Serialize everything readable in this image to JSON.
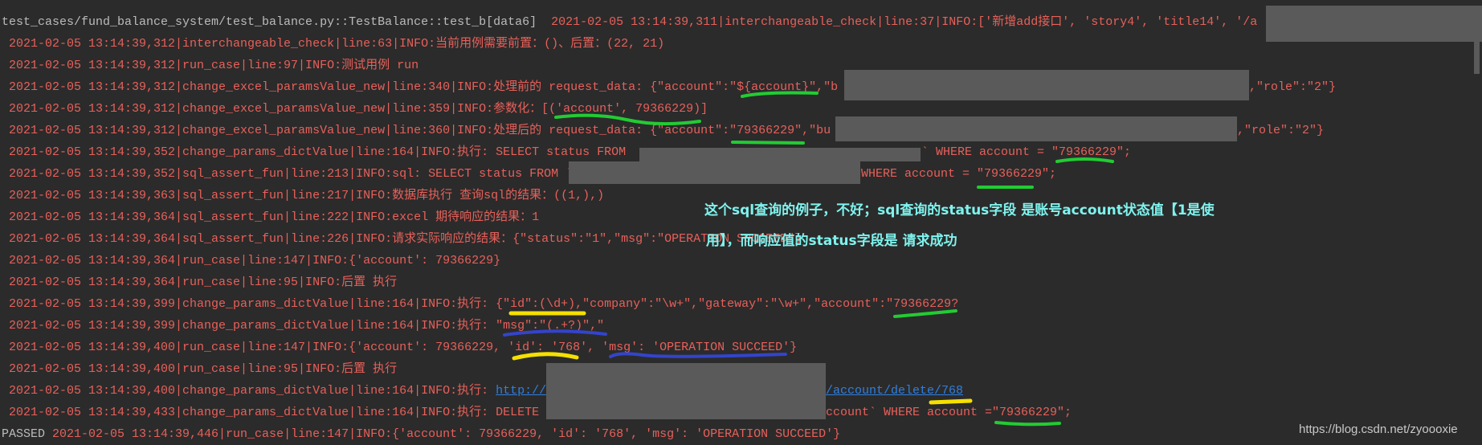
{
  "log": {
    "lines": [
      {
        "test": "test_cases/fund_balance_system/test_balance.py::TestBalance::test_b[data6]",
        "text": "  2021-02-05 13:14:39,311|interchangeable_check|line:37|INFO:['新增add接口', 'story4', 'title14', '/a"
      },
      {
        "text": " 2021-02-05 13:14:39,312|interchangeable_check|line:63|INFO:当前用例需要前置：()、后置：(22, 21)"
      },
      {
        "text": " 2021-02-05 13:14:39,312|run_case|line:97|INFO:测试用例 run"
      },
      {
        "text": " 2021-02-05 13:14:39,312|change_excel_paramsValue_new|line:340|INFO:处理前的 request_data: {\"account\":\"${account}\",\"b",
        "tail": ",\"role\":\"2\"}"
      },
      {
        "text": " 2021-02-05 13:14:39,312|change_excel_paramsValue_new|line:359|INFO:参数化：[('account', 79366229)]"
      },
      {
        "text": " 2021-02-05 13:14:39,312|change_excel_paramsValue_new|line:360|INFO:处理后的 request_data: {\"account\":\"79366229\",\"bu",
        "tail": ",\"role\":\"2\"}"
      },
      {
        "text": " 2021-02-05 13:14:39,352|change_params_dictValue|line:164|INFO:执行: SELECT status FROM ",
        "tail": "` WHERE account = \"79366229\";"
      },
      {
        "text": " 2021-02-05 13:14:39,352|sql_assert_fun|line:213|INFO:sql: SELECT status FROM `",
        "tail": "WHERE account = \"79366229\";"
      },
      {
        "text": " 2021-02-05 13:14:39,363|sql_assert_fun|line:217|INFO:数据库执行 查询sql的结果：((1,),)"
      },
      {
        "text": " 2021-02-05 13:14:39,364|sql_assert_fun|line:222|INFO:excel 期待响应的结果：1"
      },
      {
        "text": " 2021-02-05 13:14:39,364|sql_assert_fun|line:226|INFO:请求实际响应的结果：{\"status\":\"1\",\"msg\":\"OPERATION SUCCEED\"}"
      },
      {
        "text": " 2021-02-05 13:14:39,364|run_case|line:147|INFO:{'account': 79366229}"
      },
      {
        "text": " 2021-02-05 13:14:39,364|run_case|line:95|INFO:后置 执行"
      },
      {
        "text": " 2021-02-05 13:14:39,399|change_params_dictValue|line:164|INFO:执行: {\"id\":(\\d+),\"company\":\"\\w+\",\"gateway\":\"\\w+\",\"account\":\"79366229?"
      },
      {
        "text": " 2021-02-05 13:14:39,399|change_params_dictValue|line:164|INFO:执行: \"msg\":\"(.+?)\",\""
      },
      {
        "text": " 2021-02-05 13:14:39,400|run_case|line:147|INFO:{'account': 79366229, 'id': '768', 'msg': 'OPERATION SUCCEED'}"
      },
      {
        "text": " 2021-02-05 13:14:39,400|run_case|line:95|INFO:后置 执行"
      },
      {
        "text": " 2021-02-05 13:14:39,400|change_params_dictValue|line:164|INFO:执行: ",
        "link": "http://",
        "link_tail": "/account/delete/768"
      },
      {
        "text": " 2021-02-05 13:14:39,433|change_params_dictValue|line:164|INFO:执行: DELETE ",
        "tail": "ccount` WHERE account =\"79366229\";"
      },
      {
        "status": "PASSED",
        "text": " 2021-02-05 13:14:39,446|run_case|line:147|INFO:{'account': 79366229, 'id': '768', 'msg': 'OPERATION SUCCEED'}"
      }
    ]
  },
  "annotation": {
    "line1": "这个sql查询的例子，不好；sql查询的status字段 是账号account状态值【1是使",
    "line2": "用】，而响应值的status字段是 请求成功"
  },
  "watermark": "https://blog.csdn.net/zyoooxie",
  "colors": {
    "background": "#2b2b2b",
    "log_text": "#e8605a",
    "link": "#2f7fe0",
    "annotation": "#7ff3ee",
    "redaction": "#5a5a5a",
    "mark_green": "#22cc33",
    "mark_yellow": "#f5e000",
    "mark_blue": "#3344cc"
  }
}
